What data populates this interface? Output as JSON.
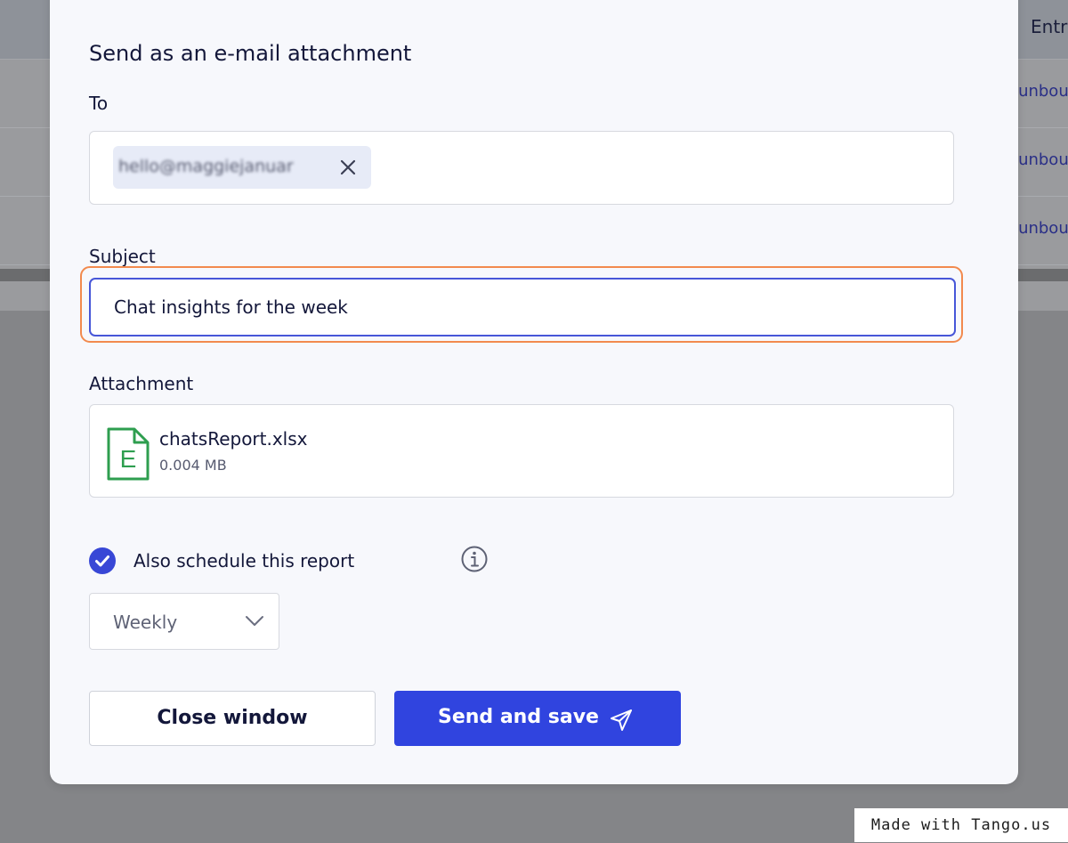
{
  "background": {
    "column_header": "Entr",
    "row_links": [
      "/unbou",
      "/unbou",
      "/unbou"
    ]
  },
  "modal": {
    "section_title": "Send as an e-mail attachment",
    "to_label": "To",
    "to_recipient": "hello@maggiejanuar",
    "subject_label": "Subject",
    "subject_value": "Chat insights for the week",
    "attachment_label": "Attachment",
    "attachment": {
      "file_name": "chatsReport.xlsx",
      "file_size": "0.004 MB",
      "icon_letter": "E"
    },
    "schedule": {
      "checked": true,
      "label": "Also schedule this report",
      "frequency": "Weekly"
    },
    "buttons": {
      "close_label": "Close window",
      "send_label": "Send and save"
    }
  },
  "watermark": "Made with Tango.us",
  "colors": {
    "primary": "#3044df",
    "focus_ring": "#f28a4e",
    "file_icon_green": "#2e9e4f",
    "overlay": "#8a8b8e"
  },
  "icons": {
    "remove_recipient": "close-icon",
    "file": "excel-file-icon",
    "checkbox": "check-icon",
    "info": "info-icon",
    "dropdown": "chevron-down-icon",
    "send": "paper-plane-icon"
  }
}
